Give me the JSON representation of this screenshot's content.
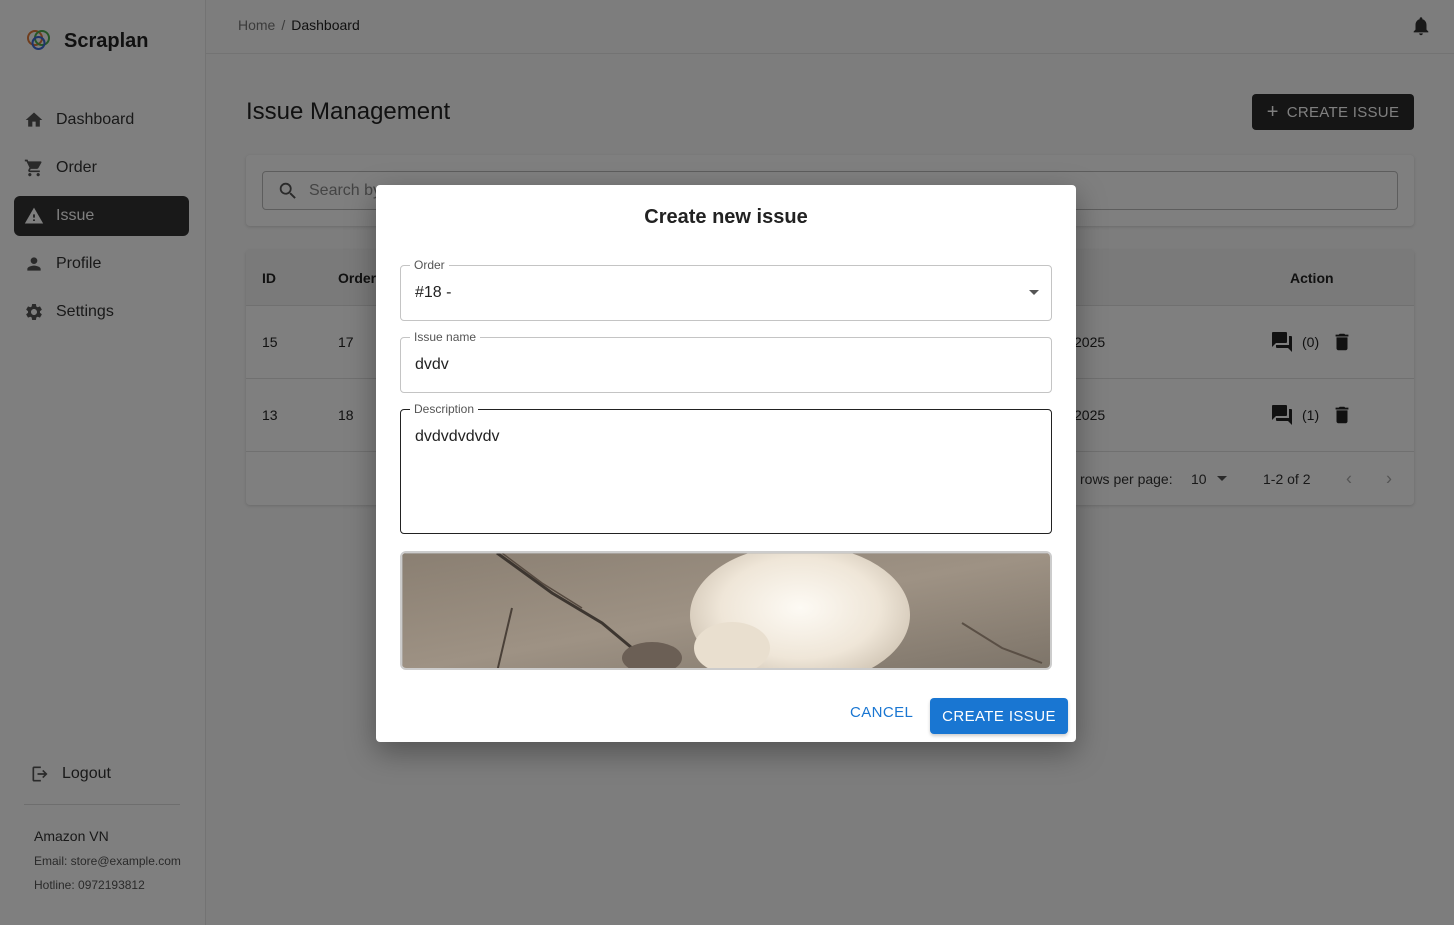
{
  "brand": {
    "name": "Scraplan",
    "logo_text": "Scraplan"
  },
  "sidebar": {
    "items": [
      {
        "label": "Dashboard",
        "icon": "home-icon"
      },
      {
        "label": "Order",
        "icon": "cart-icon"
      },
      {
        "label": "Issue",
        "icon": "warning-icon",
        "active": true
      },
      {
        "label": "Profile",
        "icon": "person-icon"
      },
      {
        "label": "Settings",
        "icon": "gear-icon"
      }
    ],
    "logout_label": "Logout",
    "store": {
      "name": "Amazon VN",
      "email": "Email: store@example.com",
      "hotline": "Hotline: 0972193812"
    }
  },
  "topbar": {
    "breadcrumb_home": "Home",
    "breadcrumb_sep": "/",
    "breadcrumb_current": "Dashboard"
  },
  "main": {
    "title": "Issue Management",
    "create_button": "CREATE ISSUE",
    "search_placeholder": "Search by",
    "table": {
      "headers": {
        "id": "ID",
        "order": "Order",
        "action": "Action"
      },
      "rows": [
        {
          "id": "15",
          "order": "17",
          "date": "2025",
          "comments": "(0)"
        },
        {
          "id": "13",
          "order": "18",
          "date": "2025",
          "comments": "(1)"
        }
      ],
      "footer": {
        "rows_per_page": "rows per page:",
        "page_size": "10",
        "range": "1-2 of 2"
      }
    }
  },
  "modal": {
    "title": "Create new issue",
    "order": {
      "label": "Order",
      "value": "#18 -"
    },
    "issue_name": {
      "label": "Issue name",
      "value": "dvdv"
    },
    "description": {
      "label": "Description",
      "value": "dvdvdvdvdv"
    },
    "cancel_label": "CANCEL",
    "create_label": "CREATE ISSUE"
  },
  "colors": {
    "accent": "#1976d2",
    "dark": "#2b2b2b"
  }
}
